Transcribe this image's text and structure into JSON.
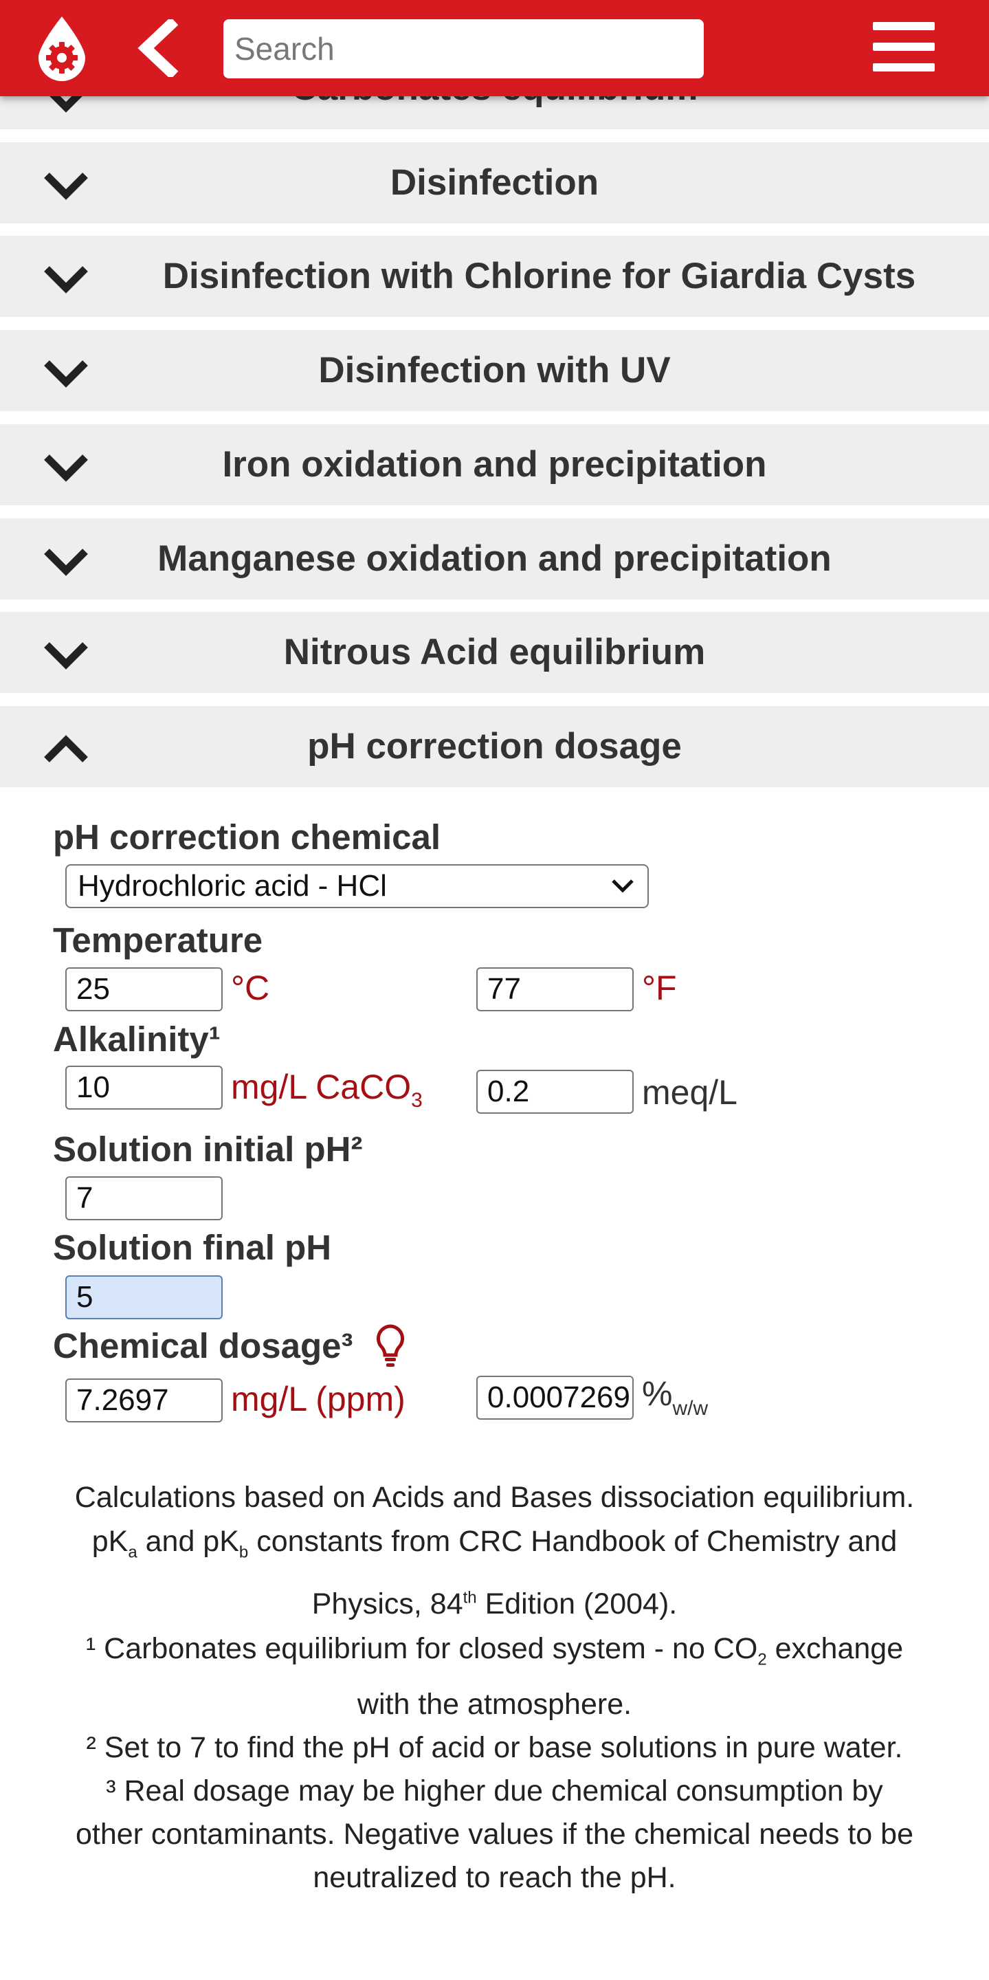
{
  "header": {
    "search_placeholder": "Search",
    "brand_color": "#d71920"
  },
  "accordion": {
    "items": [
      {
        "title": "Carbonates equilibrium",
        "expanded": false
      },
      {
        "title": "Disinfection",
        "expanded": false
      },
      {
        "title": "Disinfection with Chlorine for Giardia Cysts",
        "expanded": false
      },
      {
        "title": "Disinfection with UV",
        "expanded": false
      },
      {
        "title": "Iron oxidation and precipitation",
        "expanded": false
      },
      {
        "title": "Manganese oxidation and precipitation",
        "expanded": false
      },
      {
        "title": "Nitrous Acid equilibrium",
        "expanded": false
      },
      {
        "title": "pH correction dosage",
        "expanded": true
      }
    ]
  },
  "form": {
    "chemical_label": "pH correction chemical",
    "chemical_value": "Hydrochloric acid - HCl",
    "temperature_label": "Temperature",
    "temp_c_value": "25",
    "temp_c_unit": "°C",
    "temp_f_value": "77",
    "temp_f_unit": "°F",
    "alkalinity_label": "Alkalinity¹",
    "alk_mgl_value": "10",
    "alk_mgl_unit": "mg/L CaCO",
    "alk_mgl_unit_sub": "3",
    "alk_meq_value": "0.2",
    "alk_meq_unit": "meq/L",
    "initial_ph_label": "Solution initial pH²",
    "initial_ph_value": "7",
    "final_ph_label": "Solution final pH",
    "final_ph_value": "5",
    "dosage_label": "Chemical dosage³",
    "dosage_mgl_value": "7.2697",
    "dosage_mgl_unit": "mg/L (ppm)",
    "dosage_pct_value": "0.0007269",
    "dosage_pct_unit": "%",
    "dosage_pct_unit_sub": "w/w"
  },
  "notes": {
    "line1": "Calculations based on Acids and Bases dissociation equilibrium.",
    "line2_a": "pK",
    "line2_a_sub": "a",
    "line2_b": " and pK",
    "line2_b_sub": "b",
    "line2_c": " constants from CRC Handbook of Chemistry and",
    "line3_a": "Physics, 84",
    "line3_sup": "th",
    "line3_b": " Edition (2004).",
    "line4_a": "¹ Carbonates equilibrium for closed system - no CO",
    "line4_sub": "2",
    "line4_b": " exchange",
    "line5": "with the atmosphere.",
    "line6": "² Set to 7 to find the pH of acid or base solutions in pure water.",
    "line7": "³ Real dosage may be higher due chemical consumption by",
    "line8": "other contaminants. Negative values if the chemical needs to be",
    "line9": "neutralized to reach the pH."
  }
}
